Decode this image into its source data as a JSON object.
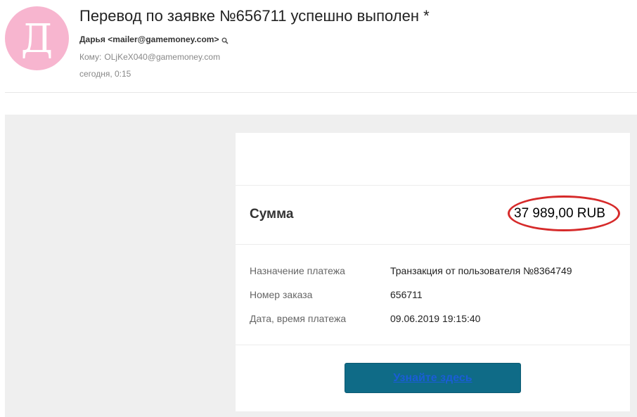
{
  "header": {
    "avatar_letter": "Д",
    "avatar_color": "#f7b5cf",
    "subject": "Перевод по заявке №656711 успешно выполен *",
    "from": "Дарья <mailer@gamemoney.com>",
    "to_label": "Кому:",
    "to_value": "OLjKeX040@gamemoney.com",
    "date": "сегодня, 0:15"
  },
  "card": {
    "sum_label": "Сумма",
    "sum_value": "37 989,00 RUB",
    "rows": [
      {
        "label": "Назначение платежа",
        "value": "Транзакция от пользователя №8364749"
      },
      {
        "label": "Номер заказа",
        "value": "656711"
      },
      {
        "label": "Дата, время платежа",
        "value": "09.06.2019 19:15:40"
      }
    ],
    "button_label": "Узнайте здесь",
    "button_color": "#0f6b87",
    "highlight_color": "#d62a2a"
  }
}
